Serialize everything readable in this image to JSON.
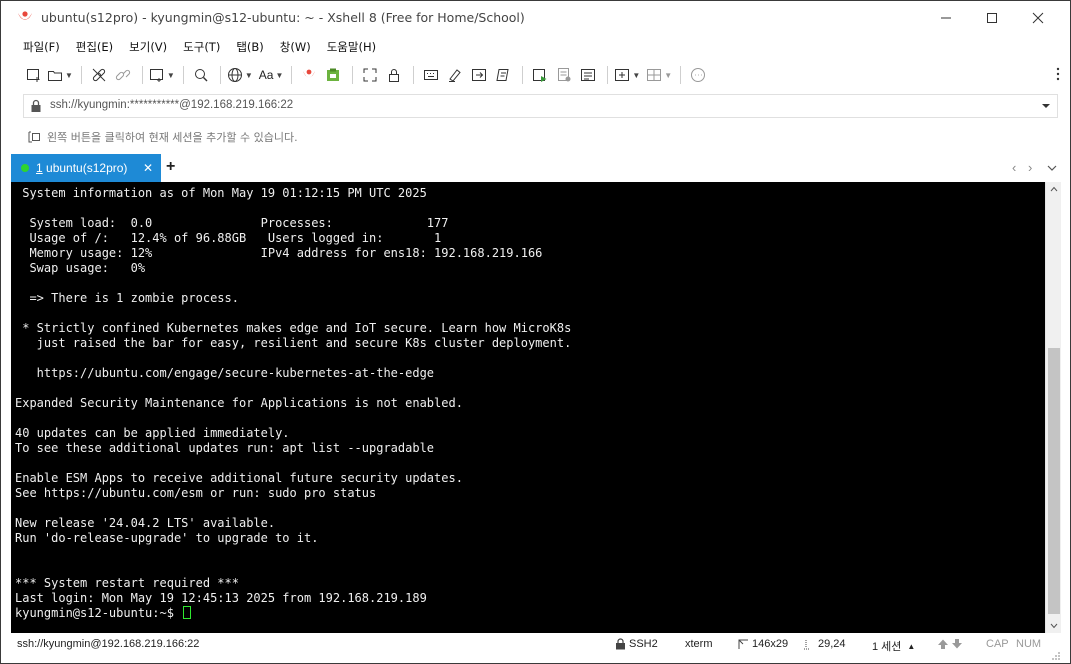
{
  "window": {
    "title": "ubuntu(s12pro) - kyungmin@s12-ubuntu: ~ - Xshell 8 (Free for Home/School)"
  },
  "menu": [
    "파일(F)",
    "편집(E)",
    "보기(V)",
    "도구(T)",
    "탭(B)",
    "창(W)",
    "도움말(H)"
  ],
  "toolbar": {
    "font_label": "Aa",
    "icons": [
      "new-session-icon",
      "open-folder-icon",
      "connect-icon",
      "disconnect-icon",
      "new-window-icon",
      "find-icon",
      "globe-icon",
      "font-icon",
      "xshell-logo-icon",
      "xftp-icon",
      "fullscreen-icon",
      "lock-icon",
      "keyboard-icon",
      "highlight-icon",
      "send-icon",
      "script-icon",
      "run-icon",
      "log-icon",
      "compose-icon",
      "new-tab-icon",
      "layout-icon",
      "chat-icon"
    ]
  },
  "address": {
    "text": "ssh://kyungmin:***********@192.168.219.166:22"
  },
  "hint": {
    "text": "왼쪽 버튼을 클릭하여 현재 세션을 추가할 수 있습니다."
  },
  "tabs": [
    {
      "number": "1",
      "label": " ubuntu(s12pro)",
      "status_color": "#2fd42f",
      "close": "✕"
    }
  ],
  "tab_add": "+",
  "terminal": {
    "lines": [
      " System information as of Mon May 19 01:12:15 PM UTC 2025",
      "",
      "  System load:  0.0               Processes:             177",
      "  Usage of /:   12.4% of 96.88GB   Users logged in:       1",
      "  Memory usage: 12%               IPv4 address for ens18: 192.168.219.166",
      "  Swap usage:   0%",
      "",
      "  => There is 1 zombie process.",
      "",
      " * Strictly confined Kubernetes makes edge and IoT secure. Learn how MicroK8s",
      "   just raised the bar for easy, resilient and secure K8s cluster deployment.",
      "",
      "   https://ubuntu.com/engage/secure-kubernetes-at-the-edge",
      "",
      "Expanded Security Maintenance for Applications is not enabled.",
      "",
      "40 updates can be applied immediately.",
      "To see these additional updates run: apt list --upgradable",
      "",
      "Enable ESM Apps to receive additional future security updates.",
      "See https://ubuntu.com/esm or run: sudo pro status",
      "",
      "New release '24.04.2 LTS' available.",
      "Run 'do-release-upgrade' to upgrade to it.",
      "",
      "",
      "*** System restart required ***",
      "Last login: Mon May 19 12:45:13 2025 from 192.168.219.189"
    ],
    "prompt": "kyungmin@s12-ubuntu:~$ "
  },
  "status": {
    "connection": "ssh://kyungmin@192.168.219.166:22",
    "protocol": "SSH2",
    "terminal_type": "xterm",
    "size": "146x29",
    "cursor_pos": "29,24",
    "sessions": "1 세션",
    "caps": "CAP",
    "num": "NUM"
  },
  "colors": {
    "accent": "#1e8ad6",
    "terminal_bg": "#000000",
    "terminal_fg": "#f0f0f0",
    "cursor": "#2fe82f",
    "logo": "#e8483c"
  }
}
